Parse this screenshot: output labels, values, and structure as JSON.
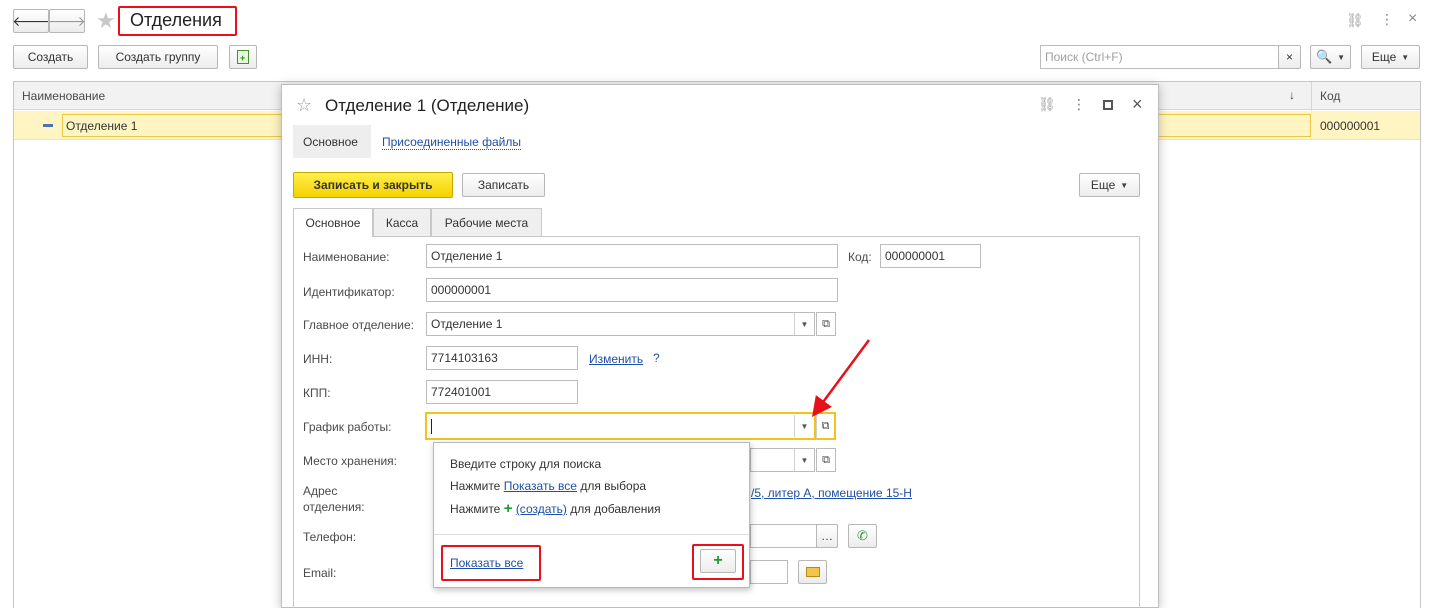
{
  "window": {
    "title": "Отделения",
    "actions": {
      "create": "Создать",
      "create_group": "Создать группу",
      "more": "Еще"
    },
    "search": {
      "placeholder": "Поиск (Ctrl+F)",
      "clear": "×"
    }
  },
  "list": {
    "columns": {
      "name": "Наименование",
      "sort_indicator": "↓",
      "code": "Код"
    },
    "rows": [
      {
        "name": "Отделение 1",
        "code": "000000001"
      }
    ]
  },
  "dialog": {
    "title": "Отделение 1 (Отделение)",
    "nav": {
      "main": "Основное",
      "files": "Присоединенные файлы"
    },
    "actions": {
      "save_close": "Записать и закрыть",
      "save": "Записать",
      "more": "Еще"
    },
    "tabs": [
      "Основное",
      "Касса",
      "Рабочие места"
    ],
    "fields": {
      "name_label": "Наименование:",
      "name_value": "Отделение 1",
      "code_label": "Код:",
      "code_value": "000000001",
      "id_label": "Идентификатор:",
      "id_value": "000000001",
      "parent_label": "Главное отделение:",
      "parent_value": "Отделение 1",
      "inn_label": "ИНН:",
      "inn_value": "7714103163",
      "inn_change": "Изменить",
      "inn_help": "?",
      "kpp_label": "КПП:",
      "kpp_value": "772401001",
      "schedule_label": "График работы:",
      "storage_label": "Место хранения:",
      "address_label_1": "Адрес",
      "address_label_2": "отделения:",
      "address_value": "/5, литер А, помещение 15-Н",
      "phone_label": "Телефон:",
      "email_label": "Email:"
    }
  },
  "dropdown": {
    "hint_search": "Введите строку для поиска",
    "hint_show_prefix": "Нажмите",
    "hint_show_link": "Показать все",
    "hint_show_suffix": "для выбора",
    "hint_create_prefix": "Нажмите",
    "hint_create_link": "(создать)",
    "hint_create_suffix": "для добавления",
    "show_all": "Показать все"
  },
  "colors": {
    "accent_yellow": "#f5d100",
    "highlight_row": "#fff5c2",
    "annotation_red": "#e8101a",
    "link": "#1d4fa8"
  }
}
